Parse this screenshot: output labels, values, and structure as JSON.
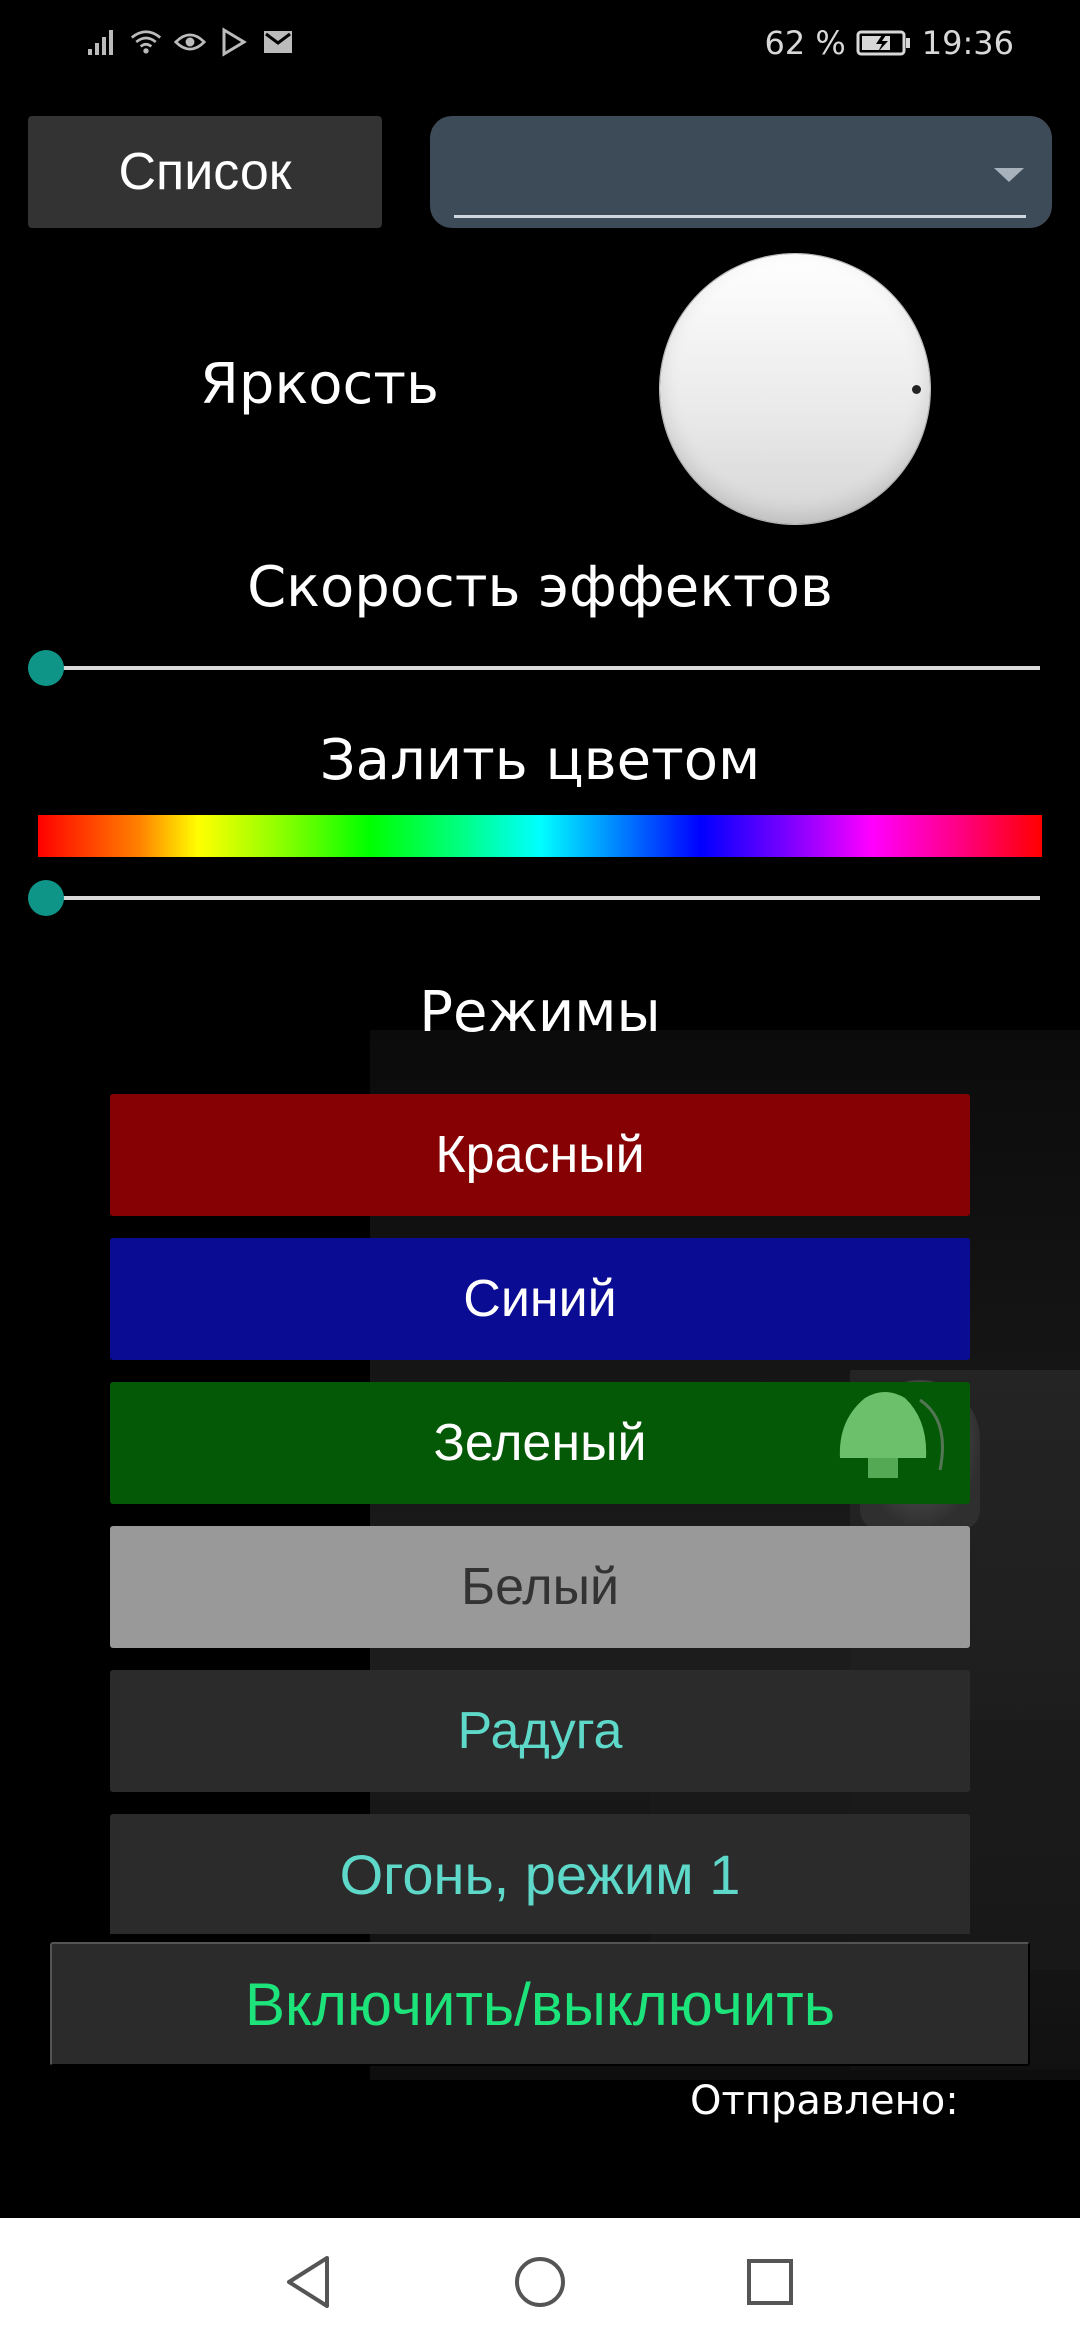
{
  "status_bar": {
    "battery_percent": "62 %",
    "time": "19:36",
    "icons": [
      "signal-icon",
      "wifi-icon",
      "eye-icon",
      "play-store-icon",
      "mail-icon",
      "battery-charging-icon"
    ]
  },
  "top": {
    "list_button": "Список",
    "dropdown_value": ""
  },
  "brightness": {
    "label": "Яркость",
    "knob_level": 0
  },
  "speed": {
    "label": "Скорость эффектов",
    "value": 0
  },
  "fill_color": {
    "label": "Залить цветом",
    "hue_value": 0
  },
  "modes": {
    "title": "Режимы",
    "items": [
      {
        "label": "Красный",
        "color": "#850103"
      },
      {
        "label": "Синий",
        "color": "#0a0c94"
      },
      {
        "label": "Зеленый",
        "color": "#045906"
      },
      {
        "label": "Белый",
        "color": "#999999"
      },
      {
        "label": "Радуга",
        "color": "#2b2b2b"
      },
      {
        "label": "Огонь, режим 1",
        "color": "#2b2b2b"
      }
    ]
  },
  "toggle_button": "Включить/выключить",
  "sent_label": "Отправлено:",
  "accent_color": "#0f9488",
  "nav": {
    "icons": [
      "back-icon",
      "home-icon",
      "recents-icon"
    ]
  }
}
